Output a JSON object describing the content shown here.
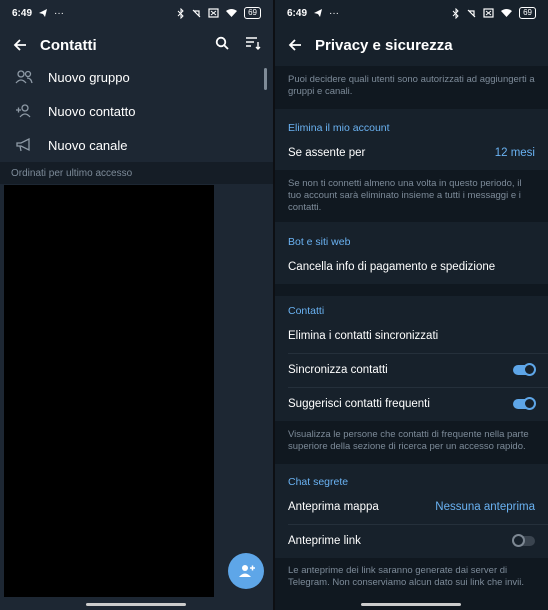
{
  "status_bar": {
    "time": "6:49",
    "battery": "69"
  },
  "left": {
    "title": "Contatti",
    "menu": [
      {
        "label": "Nuovo gruppo",
        "icon": "group-icon"
      },
      {
        "label": "Nuovo contatto",
        "icon": "add-person-icon"
      },
      {
        "label": "Nuovo canale",
        "icon": "megaphone-icon"
      }
    ],
    "sort_label": "Ordinati per ultimo accesso"
  },
  "right": {
    "title": "Privacy e sicurezza",
    "intro": "Puoi decidere quali utenti sono autorizzati ad aggiungerti a gruppi e canali.",
    "sections": {
      "delete_account": {
        "title": "Elimina il mio account",
        "row_label": "Se assente per",
        "row_value": "12 mesi",
        "info": "Se non ti connetti almeno una volta in questo periodo, il tuo account sarà eliminato insieme a tutti i messaggi e i contatti."
      },
      "bots": {
        "title": "Bot e siti web",
        "row_label": "Cancella info di pagamento e spedizione"
      },
      "contacts": {
        "title": "Contatti",
        "delete_synced": "Elimina i contatti sincronizzati",
        "sync_label": "Sincronizza contatti",
        "sync_on": true,
        "suggest_label": "Suggerisci contatti frequenti",
        "suggest_on": true,
        "info": "Visualizza le persone che contatti di frequente nella parte superiore della sezione di ricerca per un accesso rapido."
      },
      "secret_chats": {
        "title": "Chat segrete",
        "map_label": "Anteprima mappa",
        "map_value": "Nessuna anteprima",
        "links_label": "Anteprime link",
        "links_on": false,
        "info": "Le anteprime dei link saranno generate dai server di Telegram. Non conserviamo alcun dato sui link che invii."
      }
    }
  },
  "colors": {
    "accent": "#6ab2f2",
    "background": "#17212b",
    "fab": "#5ea6e8"
  }
}
